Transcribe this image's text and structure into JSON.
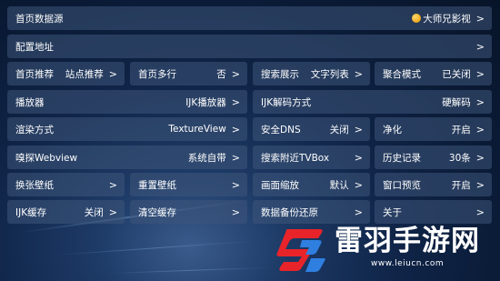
{
  "rows": {
    "home_source": {
      "label": "首页数据源",
      "value": "大师兄影视",
      "chevron": ">"
    },
    "config_url": {
      "label": "配置地址",
      "chevron": ">"
    },
    "home_recommend": {
      "label": "首页推荐",
      "value": "站点推荐",
      "chevron": ">"
    },
    "home_multirow": {
      "label": "首页多行",
      "value": "否",
      "chevron": ">"
    },
    "search_display": {
      "label": "搜索展示",
      "value": "文字列表",
      "chevron": ">"
    },
    "aggregate_mode": {
      "label": "聚合模式",
      "value": "已关闭",
      "chevron": ">"
    },
    "player": {
      "label": "播放器",
      "value": "IJK播放器",
      "chevron": ">"
    },
    "ijk_decode": {
      "label": "IJK解码方式",
      "value": "硬解码",
      "chevron": ">"
    },
    "render_mode": {
      "label": "渲染方式",
      "value": "TextureView",
      "chevron": ">"
    },
    "secure_dns": {
      "label": "安全DNS",
      "value": "关闭",
      "chevron": ">"
    },
    "purify": {
      "label": "净化",
      "value": "开启",
      "chevron": ">"
    },
    "sniff_webview": {
      "label": "嗅探Webview",
      "value": "系统自带",
      "chevron": ">"
    },
    "search_nearby_tvbox": {
      "label": "搜索附近TVBox",
      "chevron": ">"
    },
    "history": {
      "label": "历史记录",
      "value": "30条",
      "chevron": ">"
    },
    "change_wallpaper": {
      "label": "换张壁纸",
      "chevron": ">"
    },
    "reset_wallpaper": {
      "label": "重置壁纸",
      "chevron": ">"
    },
    "picture_scale": {
      "label": "画面缩放",
      "value": "默认",
      "chevron": ">"
    },
    "window_preview": {
      "label": "窗口预览",
      "value": "开启",
      "chevron": ">"
    },
    "ijk_cache": {
      "label": "IJK缓存",
      "value": "关闭",
      "chevron": ">"
    },
    "clear_cache": {
      "label": "清空缓存",
      "chevron": ">"
    },
    "backup_restore": {
      "label": "数据备份还原",
      "chevron": ">"
    },
    "about": {
      "label": "关于",
      "chevron": ">"
    }
  },
  "icons": {
    "source": "source-avatar-icon",
    "watermark_logo": "leiyu-logo-icon"
  },
  "watermark": {
    "title": "雷羽手游网",
    "url": "www.leiucn.com"
  },
  "colors": {
    "cell_bg": "#3e567a",
    "text": "#ffffff",
    "logo_red": "#e8242a",
    "logo_blue": "#2f7fe0",
    "source_icon": "#f0a91c"
  }
}
